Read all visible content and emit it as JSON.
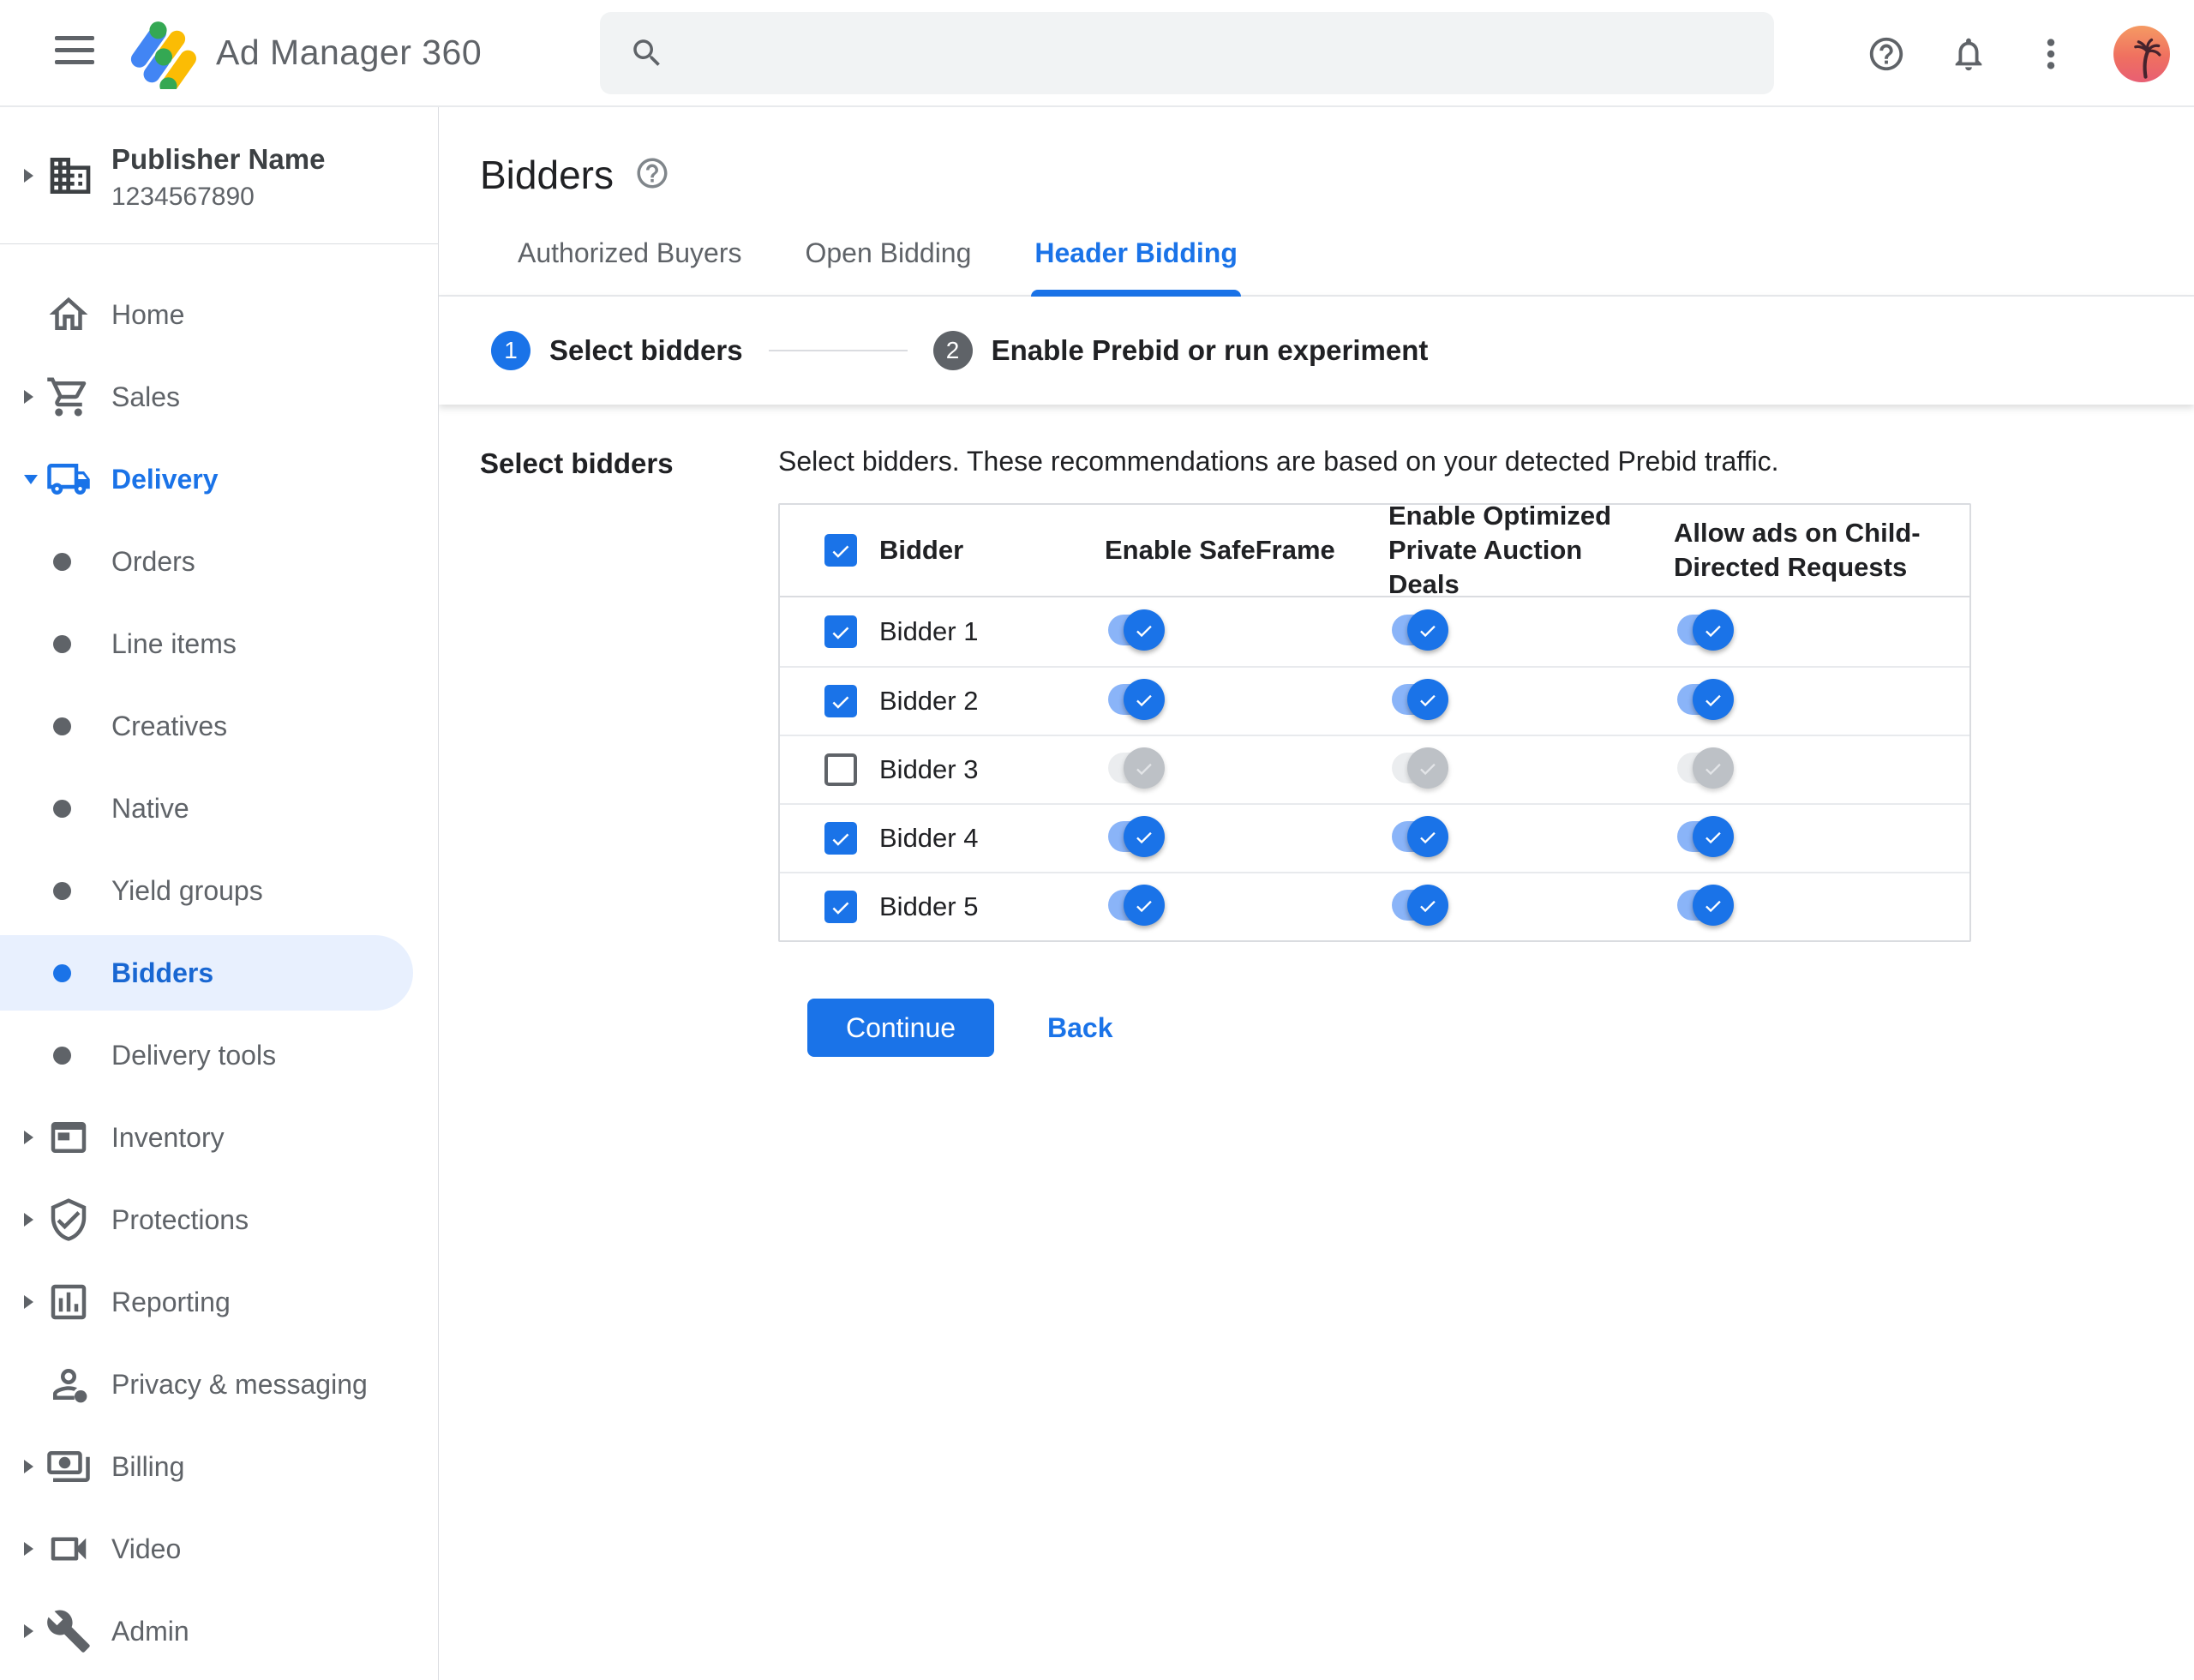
{
  "topbar": {
    "app_title": "Ad Manager 360",
    "search_placeholder": ""
  },
  "sidebar": {
    "publisher": {
      "name": "Publisher Name",
      "id": "1234567890"
    },
    "items": [
      {
        "label": "Home",
        "type": "section",
        "icon": "house"
      },
      {
        "label": "Sales",
        "type": "section",
        "icon": "shopping-cart",
        "arrow": true
      },
      {
        "label": "Delivery",
        "type": "section",
        "icon": "truck",
        "arrow": true,
        "expanded": true
      },
      {
        "label": "Orders",
        "type": "sub"
      },
      {
        "label": "Line items",
        "type": "sub"
      },
      {
        "label": "Creatives",
        "type": "sub"
      },
      {
        "label": "Native",
        "type": "sub"
      },
      {
        "label": "Yield groups",
        "type": "sub"
      },
      {
        "label": "Bidders",
        "type": "sub",
        "active": true
      },
      {
        "label": "Delivery tools",
        "type": "sub"
      },
      {
        "label": "Inventory",
        "type": "section",
        "icon": "ad-unit",
        "arrow": true
      },
      {
        "label": "Protections",
        "type": "section",
        "icon": "shield-check",
        "arrow": true
      },
      {
        "label": "Reporting",
        "type": "section",
        "icon": "bar-chart",
        "arrow": true
      },
      {
        "label": "Privacy & messaging",
        "type": "section",
        "icon": "person"
      },
      {
        "label": "Billing",
        "type": "section",
        "icon": "payments",
        "arrow": true
      },
      {
        "label": "Video",
        "type": "section",
        "icon": "video-camera",
        "arrow": true
      },
      {
        "label": "Admin",
        "type": "section",
        "icon": "wrench",
        "arrow": true
      }
    ]
  },
  "page": {
    "title": "Bidders",
    "tabs": [
      {
        "label": "Authorized Buyers",
        "active": false
      },
      {
        "label": "Open Bidding",
        "active": false
      },
      {
        "label": "Header Bidding",
        "active": true
      }
    ]
  },
  "stepper": {
    "steps": [
      {
        "number": "1",
        "label": "Select bidders",
        "state": "active"
      },
      {
        "number": "2",
        "label": "Enable Prebid or run experiment",
        "state": "upcoming"
      }
    ]
  },
  "content": {
    "section_label": "Select bidders",
    "description": "Select bidders. These recommendations are based on your detected Prebid traffic.",
    "table": {
      "select_all_checked": true,
      "columns": [
        "Bidder",
        "Enable SafeFrame",
        "Enable Optimized Private Auction Deals",
        "Allow ads on Child-Directed Requests"
      ],
      "rows": [
        {
          "name": "Bidder 1",
          "selected": true,
          "enable_safeframe": true,
          "enable_optimized_private_auction_deals": true,
          "allow_ads_child_directed": true
        },
        {
          "name": "Bidder 2",
          "selected": true,
          "enable_safeframe": true,
          "enable_optimized_private_auction_deals": true,
          "allow_ads_child_directed": true
        },
        {
          "name": "Bidder 3",
          "selected": false,
          "enable_safeframe": false,
          "enable_optimized_private_auction_deals": false,
          "allow_ads_child_directed": false
        },
        {
          "name": "Bidder 4",
          "selected": true,
          "enable_safeframe": true,
          "enable_optimized_private_auction_deals": true,
          "allow_ads_child_directed": true
        },
        {
          "name": "Bidder 5",
          "selected": true,
          "enable_safeframe": true,
          "enable_optimized_private_auction_deals": true,
          "allow_ads_child_directed": true
        }
      ]
    },
    "actions": {
      "continue_label": "Continue",
      "back_label": "Back"
    }
  },
  "colors": {
    "primary": "#1a73e8",
    "active_item_text": "#1967d2",
    "active_item_bg": "#e8f0fe",
    "text_dark": "#202124",
    "text_gray": "#5f6368",
    "border": "#dadce0",
    "row_border": "#e8eaed",
    "toggle_track_on": "#8ab4f8",
    "toggle_track_off": "#ebedef",
    "toggle_knob_off": "#bdc1c6",
    "search_bg": "#f1f3f4",
    "logo_blue": "#4285f4",
    "logo_yellow": "#fbbc04",
    "logo_green": "#34a853"
  }
}
